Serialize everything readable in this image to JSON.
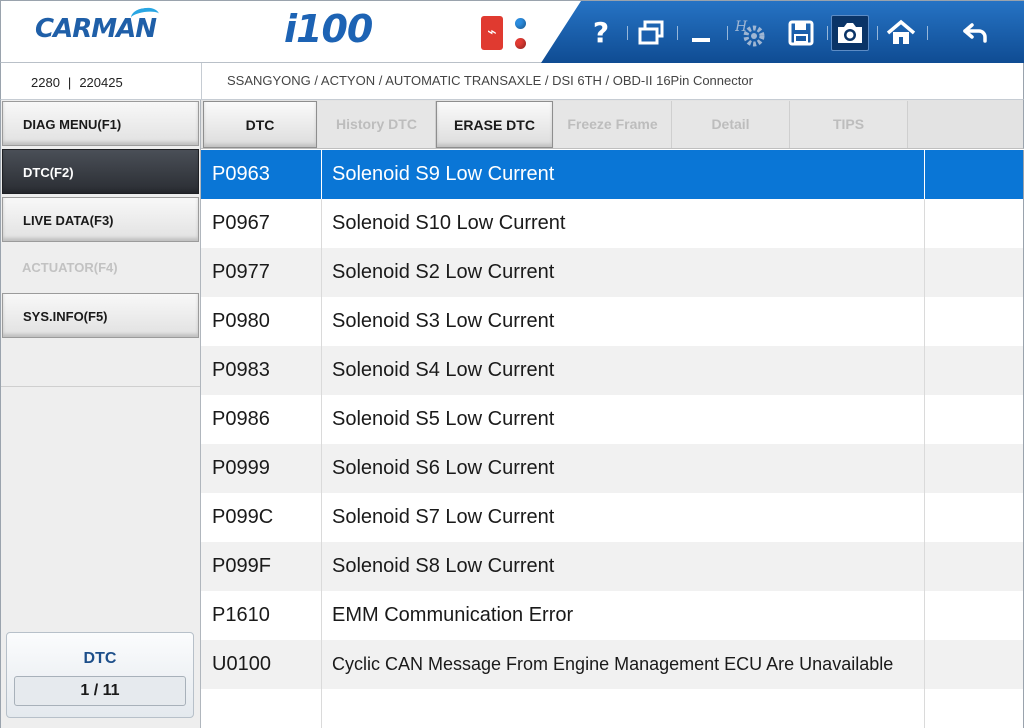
{
  "header": {
    "brand": "CARMAN",
    "model": "i100",
    "toolbar": {
      "help_symbol": "?",
      "icons": [
        "help-icon",
        "window-switch-icon",
        "minimize-icon",
        "settings-icon",
        "save-icon",
        "camera-icon",
        "home-icon",
        "back-arrow-icon"
      ],
      "active_icon": "camera-icon"
    }
  },
  "info": {
    "id1": "2280",
    "separator": "|",
    "id2": "220425",
    "vehicle_path": "SSANGYONG / ACTYON / AUTOMATIC TRANSAXLE / DSI 6TH / OBD-II 16Pin Connector"
  },
  "sidebar": {
    "items": [
      {
        "label": "DIAG MENU(F1)",
        "state": "normal"
      },
      {
        "label": "DTC(F2)",
        "state": "active"
      },
      {
        "label": "LIVE DATA(F3)",
        "state": "normal"
      },
      {
        "label": "ACTUATOR(F4)",
        "state": "disabled"
      },
      {
        "label": "SYS.INFO(F5)",
        "state": "normal"
      }
    ],
    "counter": {
      "label": "DTC",
      "value": "1 / 11"
    }
  },
  "tabs": [
    {
      "label": "DTC",
      "enabled": true
    },
    {
      "label": "History DTC",
      "enabled": false
    },
    {
      "label": "ERASE DTC",
      "enabled": true
    },
    {
      "label": "Freeze Frame",
      "enabled": false
    },
    {
      "label": "Detail",
      "enabled": false
    },
    {
      "label": "TIPS",
      "enabled": false
    }
  ],
  "dtc_list": {
    "selected_index": 0,
    "rows": [
      {
        "code": "P0963",
        "description": "Solenoid S9 Low Current"
      },
      {
        "code": "P0967",
        "description": "Solenoid S10 Low Current"
      },
      {
        "code": "P0977",
        "description": "Solenoid S2 Low Current"
      },
      {
        "code": "P0980",
        "description": "Solenoid S3 Low Current"
      },
      {
        "code": "P0983",
        "description": "Solenoid S4 Low Current"
      },
      {
        "code": "P0986",
        "description": "Solenoid S5 Low Current"
      },
      {
        "code": "P0999",
        "description": "Solenoid S6 Low Current"
      },
      {
        "code": "P099C",
        "description": "Solenoid S7 Low Current"
      },
      {
        "code": "P099F",
        "description": "Solenoid S8 Low Current"
      },
      {
        "code": "P1610",
        "description": "EMM Communication Error"
      },
      {
        "code": "U0100",
        "description": "Cyclic CAN Message From Engine Management ECU Are Unavailable"
      },
      {
        "code": "",
        "description": ""
      }
    ]
  },
  "colors": {
    "brand_blue": "#1f5fa8",
    "toolbar_blue": "#1a5fae",
    "selection_blue": "#0a76d6",
    "active_menu": "#2a2d33"
  }
}
